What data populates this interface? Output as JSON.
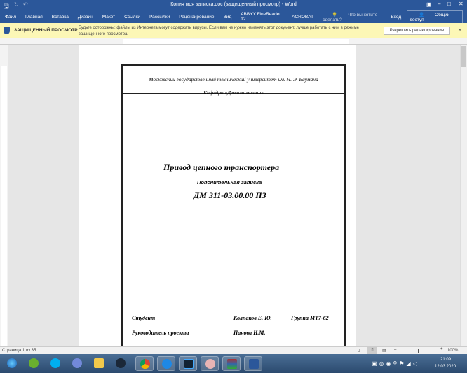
{
  "window": {
    "title": "Копия моя записка.doc (защищенный просмотр) - Word"
  },
  "ribbon": {
    "tabs": [
      "Файл",
      "Главная",
      "Вставка",
      "Дизайн",
      "Макет",
      "Ссылки",
      "Рассылки",
      "Рецензирование",
      "Вид",
      "ABBYY FineReader 12",
      "ACROBAT"
    ],
    "tell_me": "Что вы хотите сделать?",
    "signin": "Вход",
    "share": "Общий доступ"
  },
  "protected": {
    "title": "ЗАЩИЩЕННЫЙ ПРОСМОТР",
    "message": "Будьте осторожны: файлы из Интернета могут содержать вирусы. Если вам не нужно изменять этот документ, лучше работать с ним в режиме защищенного просмотра.",
    "button": "Разрешить редактирование"
  },
  "document": {
    "university": "Московский государственный технический университет им. Н. Э. Баумана",
    "department": "Кафедра «Детали машин»",
    "title": "Привод цепного транспортера",
    "subtitle": "Пояснительная записка",
    "code": "ДМ 311-03.00.00 ПЗ",
    "student_label": "Студент",
    "student_name": "Колпаков Е. Ю.",
    "group": "Группа МТ7-62",
    "supervisor_label": "Руководитель проекта",
    "supervisor_name": "Панова И.М."
  },
  "status": {
    "page": "Страница 1 из 35",
    "zoom": "100%"
  },
  "tray": {
    "time": "21:09",
    "date": "12.03.2020"
  }
}
